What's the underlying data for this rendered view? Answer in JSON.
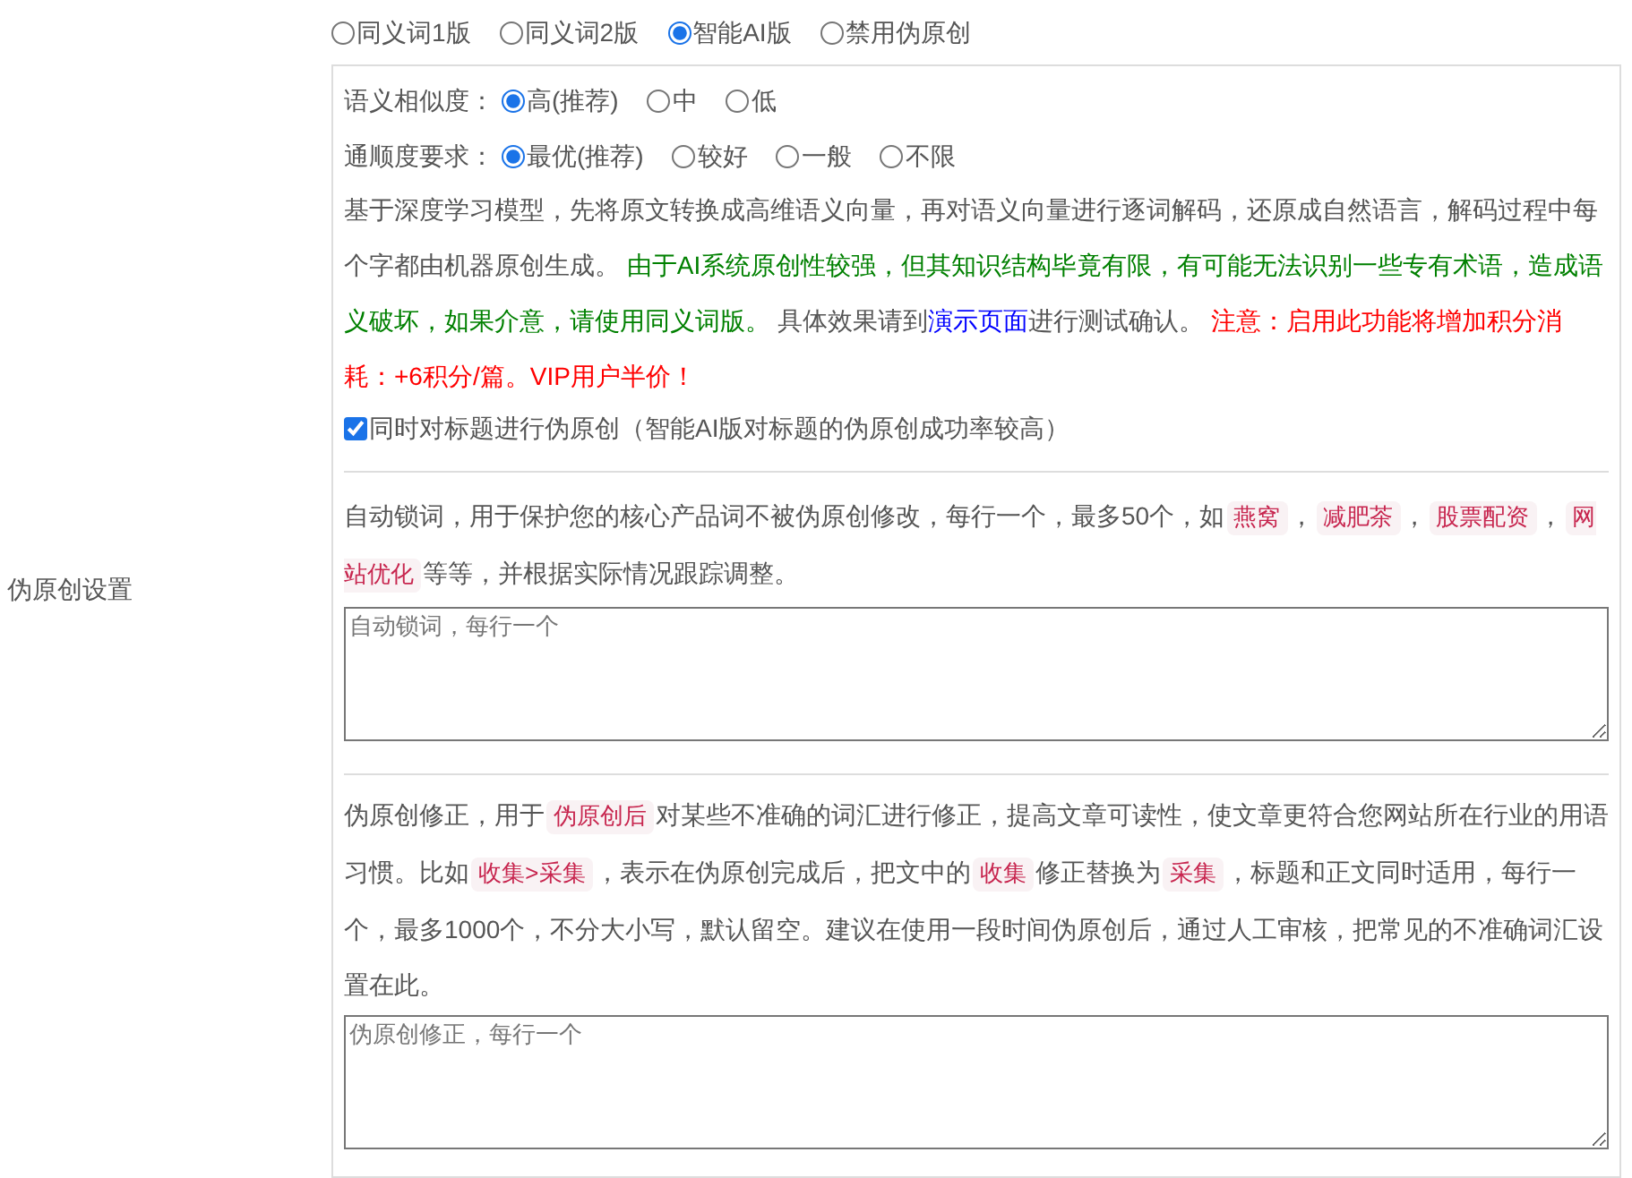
{
  "section_label": "伪原创设置",
  "mode_options": [
    {
      "label": "同义词1版",
      "selected": false
    },
    {
      "label": "同义词2版",
      "selected": false
    },
    {
      "label": "智能AI版",
      "selected": true
    },
    {
      "label": "禁用伪原创",
      "selected": false
    }
  ],
  "similarity": {
    "label": "语义相似度：",
    "options": [
      {
        "label": "高(推荐)",
        "selected": true
      },
      {
        "label": "中",
        "selected": false
      },
      {
        "label": "低",
        "selected": false
      }
    ]
  },
  "fluency": {
    "label": "通顺度要求：",
    "options": [
      {
        "label": "最优(推荐)",
        "selected": true
      },
      {
        "label": "较好",
        "selected": false
      },
      {
        "label": "一般",
        "selected": false
      },
      {
        "label": "不限",
        "selected": false
      }
    ]
  },
  "description": [
    {
      "kind": "text",
      "text": "基于深度学习模型，先将原文转换成高维语义向量，再对语义向量进行逐词解码，还原成自然语言，解码过程中每个字都由机器原创生成。 "
    },
    {
      "kind": "green",
      "text": "由于AI系统原创性较强，但其知识结构毕竟有限，有可能无法识别一些专有术语，造成语义破坏，如果介意，请使用同义词版。"
    },
    {
      "kind": "text",
      "text": " 具体效果请到"
    },
    {
      "kind": "link",
      "text": "演示页面"
    },
    {
      "kind": "text",
      "text": "进行测试确认。 "
    },
    {
      "kind": "red",
      "text": "注意：启用此功能将增加积分消耗：+6积分/篇。VIP用户半价！"
    }
  ],
  "title_checkbox": {
    "label": "同时对标题进行伪原创（智能AI版对标题的伪原创成功率较高）",
    "checked": true
  },
  "lock_words": {
    "segments": [
      {
        "kind": "text",
        "text": "自动锁词，用于保护您的核心产品词不被伪原创修改，每行一个，最多50个，如"
      },
      {
        "kind": "code",
        "text": "燕窝"
      },
      {
        "kind": "text",
        "text": "，"
      },
      {
        "kind": "code",
        "text": "减肥茶"
      },
      {
        "kind": "text",
        "text": "，"
      },
      {
        "kind": "code",
        "text": "股票配资"
      },
      {
        "kind": "text",
        "text": "，"
      },
      {
        "kind": "code",
        "text": "网站优化"
      },
      {
        "kind": "text",
        "text": "等等，并根据实际情况跟踪调整。"
      }
    ],
    "placeholder": "自动锁词，每行一个"
  },
  "correction": {
    "segments": [
      {
        "kind": "text",
        "text": "伪原创修正，用于"
      },
      {
        "kind": "code",
        "text": "伪原创后"
      },
      {
        "kind": "text",
        "text": "对某些不准确的词汇进行修正，提高文章可读性，使文章更符合您网站所在行业的用语习惯。比如"
      },
      {
        "kind": "code",
        "text": "收集>采集"
      },
      {
        "kind": "text",
        "text": "，表示在伪原创完成后，把文中的"
      },
      {
        "kind": "code",
        "text": "收集"
      },
      {
        "kind": "text",
        "text": "修正替换为"
      },
      {
        "kind": "code",
        "text": "采集"
      },
      {
        "kind": "text",
        "text": "，标题和正文同时适用，每行一个，最多1000个，不分大小写，默认留空。建议在使用一段时间伪原创后，通过人工审核，把常见的不准确词汇设置在此。"
      }
    ],
    "placeholder": "伪原创修正，每行一个"
  }
}
